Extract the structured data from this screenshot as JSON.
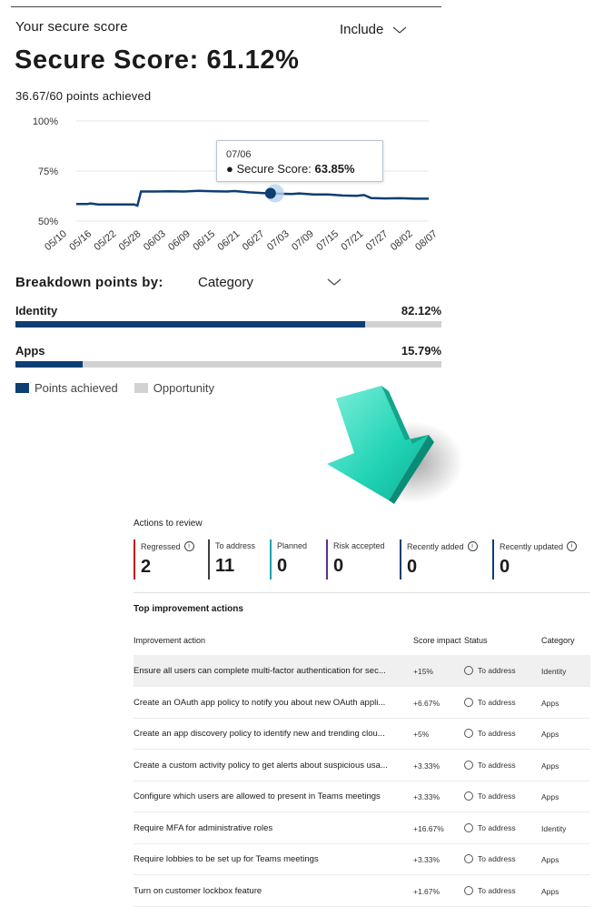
{
  "score_card": {
    "title": "Your secure score",
    "include_label": "Include",
    "score_text": "Secure Score: 61.12%",
    "points_text": "36.67/60 points achieved",
    "tooltip": {
      "date": "07/06",
      "label": "Secure Score:",
      "value": "63.85%"
    },
    "breakdown_label": "Breakdown points by:",
    "breakdown_value": "Category",
    "bars": [
      {
        "name": "Identity",
        "percent_text": "82.12%",
        "fraction": 0.8212
      },
      {
        "name": "Apps",
        "percent_text": "15.79%",
        "fraction": 0.1579
      }
    ],
    "legend": {
      "achieved": "Points achieved",
      "opportunity": "Opportunity"
    },
    "colors": {
      "achieved": "#0e3e72",
      "opportunity": "#d2d2d2"
    }
  },
  "chart_data": {
    "type": "line",
    "x": [
      "05/10",
      "05/16",
      "05/22",
      "05/28",
      "06/03",
      "06/09",
      "06/15",
      "06/21",
      "06/27",
      "07/03",
      "07/09",
      "07/15",
      "07/21",
      "07/27",
      "08/02",
      "08/07"
    ],
    "y_ticks": [
      "100%",
      "75%",
      "50%"
    ],
    "ylim": [
      50,
      100
    ],
    "series": [
      {
        "values": [
          [
            0,
            58.5
          ],
          [
            3,
            58.5
          ],
          [
            4,
            58.8
          ],
          [
            6,
            58.3
          ],
          [
            8,
            58.3
          ],
          [
            12,
            58.3
          ],
          [
            16,
            58.3
          ],
          [
            17,
            57.7
          ],
          [
            18,
            64.8
          ],
          [
            22,
            64.8
          ],
          [
            26,
            64.9
          ],
          [
            30,
            64.8
          ],
          [
            34,
            65.1
          ],
          [
            38,
            64.9
          ],
          [
            42,
            64.8
          ],
          [
            44,
            65.0
          ],
          [
            48,
            64.4
          ],
          [
            52,
            64.0
          ],
          [
            54,
            63.85
          ],
          [
            56,
            63.7
          ],
          [
            60,
            63.5
          ],
          [
            62,
            63.8
          ],
          [
            66,
            63.3
          ],
          [
            70,
            63.3
          ],
          [
            74,
            62.8
          ],
          [
            78,
            62.6
          ],
          [
            80,
            63.0
          ],
          [
            82,
            61.5
          ],
          [
            86,
            61.3
          ],
          [
            90,
            61.4
          ],
          [
            94,
            61.2
          ],
          [
            98,
            61.2
          ]
        ]
      }
    ],
    "highlight": {
      "x": "07/06",
      "y": 63.85
    }
  },
  "actions": {
    "title": "Actions to review",
    "counters": [
      {
        "label": "Regressed",
        "value": "2",
        "color": "#c50f1f",
        "info": true
      },
      {
        "label": "To address",
        "value": "11",
        "color": "#3d3d3d",
        "info": false
      },
      {
        "label": "Planned",
        "value": "0",
        "color": "#1fa0b4",
        "info": false
      },
      {
        "label": "Risk accepted",
        "value": "0",
        "color": "#5c2e91",
        "info": false
      },
      {
        "label": "Recently added",
        "value": "0",
        "color": "#0e3e72",
        "info": true
      },
      {
        "label": "Recently updated",
        "value": "0",
        "color": "#0e3e72",
        "info": true
      }
    ],
    "top_title": "Top improvement actions",
    "columns": {
      "action": "Improvement action",
      "impact": "Score impact",
      "status": "Status",
      "category": "Category"
    },
    "rows": [
      {
        "action": "Ensure all users can complete multi-factor authentication for sec...",
        "impact": "+15%",
        "status": "To address",
        "category": "Identity"
      },
      {
        "action": "Create an OAuth app policy to notify you about new OAuth appli...",
        "impact": "+6.67%",
        "status": "To address",
        "category": "Apps"
      },
      {
        "action": "Create an app discovery policy to identify new and trending clou...",
        "impact": "+5%",
        "status": "To address",
        "category": "Apps"
      },
      {
        "action": "Create a custom activity policy to get alerts about suspicious usa...",
        "impact": "+3.33%",
        "status": "To address",
        "category": "Apps"
      },
      {
        "action": "Configure which users are allowed to present in Teams meetings",
        "impact": "+3.33%",
        "status": "To address",
        "category": "Apps"
      },
      {
        "action": "Require MFA for administrative roles",
        "impact": "+16.67%",
        "status": "To address",
        "category": "Identity"
      },
      {
        "action": "Require lobbies to be set up for Teams meetings",
        "impact": "+3.33%",
        "status": "To address",
        "category": "Apps"
      },
      {
        "action": "Turn on customer lockbox feature",
        "impact": "+1.67%",
        "status": "To address",
        "category": "Apps"
      }
    ]
  }
}
